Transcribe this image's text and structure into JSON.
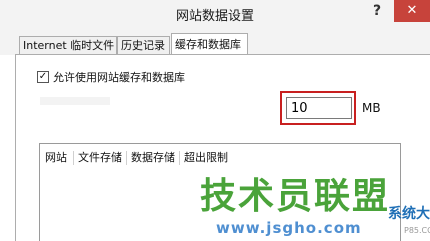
{
  "window": {
    "title": "网站数据设置",
    "help": "?",
    "close": "✕"
  },
  "tabs": [
    {
      "label": "Internet 临时文件",
      "active": false
    },
    {
      "label": "历史记录",
      "active": false
    },
    {
      "label": "缓存和数据库",
      "active": true
    }
  ],
  "cache": {
    "allow_checkbox": {
      "label": "允许使用网站缓存和数据库",
      "checked": true,
      "mark": "✓"
    },
    "size_value": "10",
    "size_unit": "MB"
  },
  "table": {
    "columns": [
      "网站",
      "文件存储",
      "数据存储",
      "超出限制"
    ]
  },
  "watermark": {
    "text": "技术员联盟",
    "url": "www.jsgho.com",
    "side": "系统大全",
    "mini": "P85.COM"
  },
  "colors": {
    "close_button": "#c7433b",
    "highlight_border": "#c82020",
    "watermark_green": "#4aa33a",
    "watermark_blue": "#4f8fd1"
  }
}
